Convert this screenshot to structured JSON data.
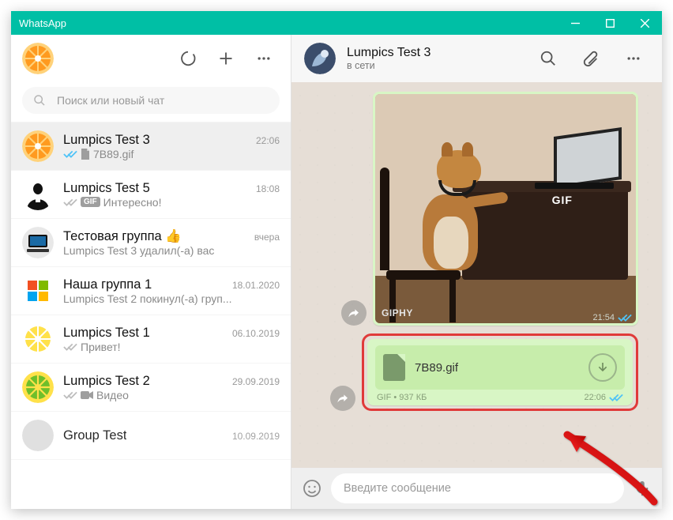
{
  "window": {
    "title": "WhatsApp"
  },
  "search": {
    "placeholder": "Поиск или новый чат"
  },
  "chats": [
    {
      "name": "Lumpics Test 3",
      "time": "22:06",
      "preview_text": "7B89.gif",
      "status": "read",
      "preview_prefix_icon": "doc",
      "active": true,
      "avatar": "orange"
    },
    {
      "name": "Lumpics Test 5",
      "time": "18:08",
      "preview_text": "Интересно!",
      "status": "sent",
      "preview_prefix_icon": "gif",
      "avatar": "suit"
    },
    {
      "name": "Тестовая группа 👍",
      "time": "вчера",
      "preview_text": "Lumpics Test 3 удалил(-а) вас",
      "status": "none",
      "avatar": "pc"
    },
    {
      "name": "Наша группа 1",
      "time": "18.01.2020",
      "preview_text": "Lumpics Test 2 покинул(-а) груп...",
      "status": "none",
      "avatar": "win"
    },
    {
      "name": "Lumpics Test 1",
      "time": "06.10.2019",
      "preview_text": "Привет!",
      "status": "sent",
      "avatar": "lemon"
    },
    {
      "name": "Lumpics Test 2",
      "time": "29.09.2019",
      "preview_text": "Видео",
      "status": "sent",
      "preview_prefix_icon": "video",
      "avatar": "lime"
    },
    {
      "name": "Group Test",
      "time": "10.09.2019",
      "preview_text": "",
      "status": "none",
      "avatar": "blank"
    }
  ],
  "conversation": {
    "name": "Lumpics Test 3",
    "status": "в сети",
    "gif_msg": {
      "giphy_label": "GIPHY",
      "gif_badge": "GIF",
      "time": "21:54"
    },
    "file_msg": {
      "filename": "7B89.gif",
      "meta": "GIF • 937 КБ",
      "time": "22:06"
    }
  },
  "composer": {
    "placeholder": "Введите сообщение"
  }
}
